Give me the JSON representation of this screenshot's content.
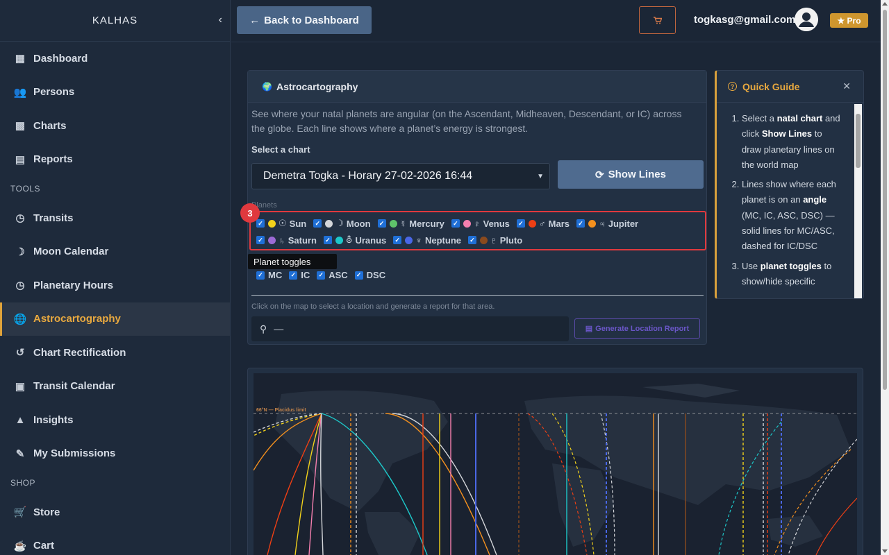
{
  "brand": "KALHAS",
  "sidebar": {
    "items": [
      {
        "label": "Dashboard",
        "icon": "dashboard-icon"
      },
      {
        "label": "Persons",
        "icon": "people-icon"
      },
      {
        "label": "Charts",
        "icon": "bar-chart-icon"
      },
      {
        "label": "Reports",
        "icon": "reports-icon"
      }
    ],
    "tools_label": "TOOLS",
    "tools": [
      {
        "label": "Transits",
        "icon": "clock-icon"
      },
      {
        "label": "Moon Calendar",
        "icon": "moon-icon"
      },
      {
        "label": "Planetary Hours",
        "icon": "clock-icon"
      },
      {
        "label": "Astrocartography",
        "icon": "globe-icon"
      },
      {
        "label": "Chart Rectification",
        "icon": "history-icon"
      },
      {
        "label": "Transit Calendar",
        "icon": "calendar-icon"
      },
      {
        "label": "Insights",
        "icon": "insights-icon"
      },
      {
        "label": "My Submissions",
        "icon": "submissions-icon"
      }
    ],
    "shop_label": "SHOP",
    "shop": [
      {
        "label": "Store",
        "icon": "cart-icon"
      },
      {
        "label": "Cart",
        "icon": "basket-icon"
      }
    ]
  },
  "topbar": {
    "back_label": "Back to Dashboard",
    "email": "togkasg@gmail.com",
    "pro_label": "Pro"
  },
  "card": {
    "title": "Astrocartography",
    "description": "See where your natal planets are angular (on the Ascendant, Midheaven, Descendant, or IC) across the globe. Each line shows where a planet’s energy is strongest.",
    "select_label": "Select a chart",
    "selected_chart": "Demetra Togka - Horary 27-02-2026 16:44",
    "show_lines_label": "Show Lines",
    "planets_label": "Planets",
    "planets_row1": [
      {
        "label": "Sun",
        "glyph": "☉",
        "color": "#f2d21b"
      },
      {
        "label": "Moon",
        "glyph": "☽",
        "color": "#d4d6da"
      },
      {
        "label": "Mercury",
        "glyph": "☿",
        "color": "#5fc26b"
      },
      {
        "label": "Venus",
        "glyph": "♀",
        "color": "#f47fae"
      },
      {
        "label": "Mars",
        "glyph": "♂",
        "color": "#ee3f14"
      },
      {
        "label": "Jupiter",
        "glyph": "♃",
        "color": "#f4901e"
      }
    ],
    "planets_row2": [
      {
        "label": "Saturn",
        "glyph": "♄",
        "color": "#9c6ad6"
      },
      {
        "label": "Uranus",
        "glyph": "⛢",
        "color": "#1dc7c9"
      },
      {
        "label": "Neptune",
        "glyph": "♆",
        "color": "#4a67e6"
      },
      {
        "label": "Pluto",
        "glyph": "♇",
        "color": "#8a4a1e"
      }
    ],
    "step_badge": "3",
    "tooltip": "Planet toggles",
    "angles": [
      "MC",
      "IC",
      "ASC",
      "DSC"
    ],
    "hint": "Click on the map to select a location and generate a report for that area.",
    "location_value": "—",
    "generate_label": "Generate Location Report"
  },
  "guide": {
    "title": "Quick Guide",
    "steps": [
      [
        "Select a ",
        "natal chart",
        " and click ",
        "Show Lines",
        " to draw planetary lines on the world map"
      ],
      [
        "Lines show where each planet is on an ",
        "angle",
        " (MC, IC, ASC, DSC) — solid lines for MC/ASC, dashed for IC/DSC"
      ],
      [
        "Use ",
        "planet toggles",
        " to show/hide specific"
      ]
    ]
  },
  "map": {
    "limit_label": "66°N — Placidus limit"
  }
}
